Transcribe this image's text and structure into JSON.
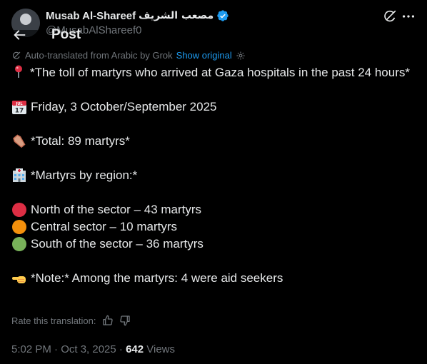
{
  "author": {
    "name": "Musab Al-Shareef",
    "name_arabic": "مصعب الشريف",
    "handle": "@MusabAlShareef0"
  },
  "nav": {
    "title": "Post"
  },
  "translation": {
    "notice": "Auto-translated from Arabic by Grok",
    "show_original": "Show original"
  },
  "post": {
    "line1": "*The toll of martyrs who arrived at Gaza hospitals in the past 24 hours*",
    "date_line": "Friday, 3 October/September 2025",
    "total_line": "*Total: 89 martyrs*",
    "region_header": "*Martyrs by region:*",
    "regions": [
      {
        "label": "North of the sector – 43 martyrs",
        "color": "#dd2e44"
      },
      {
        "label": "Central sector – 10 martyrs",
        "color": "#f4900c"
      },
      {
        "label": "South of the sector – 36 martyrs",
        "color": "#78b159"
      }
    ],
    "note_line": "*Note:* Among the martyrs: 4 were aid seekers",
    "calendar_month": "JUL",
    "calendar_day": "17"
  },
  "rate": {
    "label": "Rate this translation:"
  },
  "meta": {
    "time_date": "5:02 PM · Oct 3, 2025 · ",
    "views_count": "642",
    "views_label": " Views"
  },
  "colors": {
    "background": "#000000",
    "text": "#e7e9ea",
    "secondary": "#71767b",
    "link": "#1d9bf0",
    "verified": "#1d9bf0"
  },
  "icons": {
    "back": "arrow-left-icon",
    "grok": "grok-icon",
    "more": "more-icon",
    "pin": "round-pushpin-icon",
    "calendar": "calendar-icon",
    "coffin": "coffin-icon",
    "hospital": "hospital-icon",
    "pointing": "backhand-index-pointing-left-icon"
  }
}
